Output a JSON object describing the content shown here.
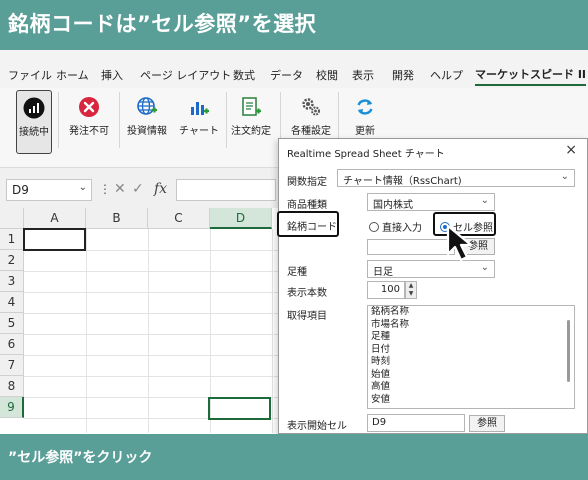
{
  "banner": {
    "title": "銘柄コードは”セル参照”を選択"
  },
  "ribbon_tabs": [
    "ファイル",
    "ホーム",
    "挿入",
    "ページ レイアウト",
    "数式",
    "データ",
    "校閲",
    "表示",
    "開発",
    "ヘルプ",
    "マーケットスピード II"
  ],
  "ribbon_buttons": [
    "接続中",
    "発注不可",
    "投資情報",
    "チャート",
    "注文約定",
    "各種設定",
    "更新"
  ],
  "formula_bar": {
    "name_box": "D9",
    "fx": "fx"
  },
  "grid": {
    "columns": [
      "A",
      "B",
      "C",
      "D"
    ],
    "rows": [
      "1",
      "2",
      "3",
      "4",
      "5",
      "6",
      "7",
      "8",
      "9"
    ],
    "selected_cell": "D9"
  },
  "dialog": {
    "title": "Realtime Spread Sheet チャート",
    "close": "×",
    "func_label": "関数指定",
    "func_value": "チャート情報（RssChart)",
    "product_label": "商品種類",
    "product_value": "国内株式",
    "code_label": "銘柄コード",
    "radio_direct": "直接入力",
    "radio_cell": "セル参照",
    "ref_button": "参照",
    "foot_label": "足種",
    "foot_value": "日足",
    "count_label": "表示本数",
    "count_value": "100",
    "items_label": "取得項目",
    "items": [
      "銘柄名称",
      "市場名称",
      "足種",
      "日付",
      "時刻",
      "始値",
      "高値",
      "安値"
    ],
    "start_label": "表示開始セル",
    "start_value": "D9",
    "start_ref_button": "参照"
  },
  "bottom_banner": {
    "text": "”セル参照”をクリック"
  },
  "colors": {
    "banner": "#5a9e98",
    "accent": "#1d6b3a",
    "radio_selected": "#1b6ac9"
  }
}
